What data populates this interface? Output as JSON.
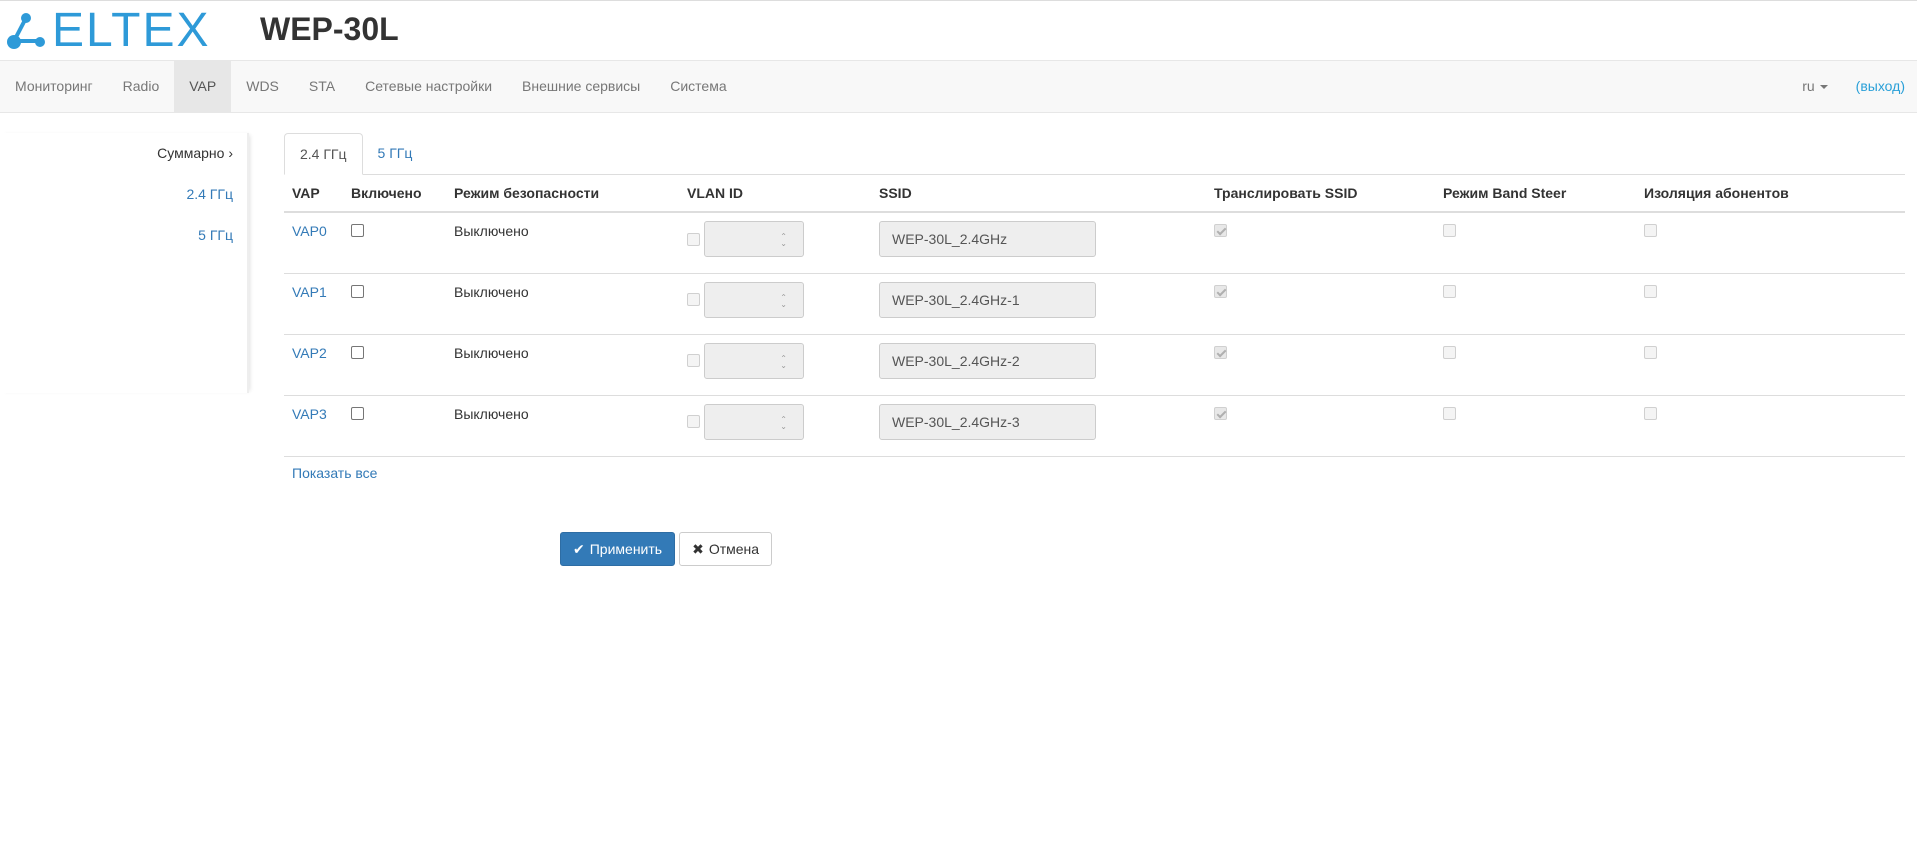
{
  "header": {
    "logo_text": "ELTEX",
    "device_title": "WEP-30L"
  },
  "nav": {
    "items": [
      {
        "label": "Мониторинг"
      },
      {
        "label": "Radio"
      },
      {
        "label": "VAP",
        "active": true
      },
      {
        "label": "WDS"
      },
      {
        "label": "STA"
      },
      {
        "label": "Сетевые настройки"
      },
      {
        "label": "Внешние сервисы"
      },
      {
        "label": "Система"
      }
    ],
    "language": "ru",
    "logout": "(выход)"
  },
  "sidebar": {
    "items": [
      {
        "label": "Суммарно ›",
        "active": true
      },
      {
        "label": "2.4 ГГц"
      },
      {
        "label": "5 ГГц"
      }
    ]
  },
  "tabs": [
    {
      "label": "2.4 ГГц",
      "active": true
    },
    {
      "label": "5 ГГц"
    }
  ],
  "table": {
    "headers": [
      "VAP",
      "Включено",
      "Режим безопасности",
      "VLAN ID",
      "SSID",
      "Транслировать SSID",
      "Режим Band Steer",
      "Изоляция абонентов"
    ],
    "rows": [
      {
        "vap": "VAP0",
        "enabled": false,
        "security": "Выключено",
        "vlan": "",
        "ssid": "WEP-30L_2.4GHz",
        "broadcast": true,
        "band_steer": false,
        "isolation": false
      },
      {
        "vap": "VAP1",
        "enabled": false,
        "security": "Выключено",
        "vlan": "",
        "ssid": "WEP-30L_2.4GHz-1",
        "broadcast": true,
        "band_steer": false,
        "isolation": false
      },
      {
        "vap": "VAP2",
        "enabled": false,
        "security": "Выключено",
        "vlan": "",
        "ssid": "WEP-30L_2.4GHz-2",
        "broadcast": true,
        "band_steer": false,
        "isolation": false
      },
      {
        "vap": "VAP3",
        "enabled": false,
        "security": "Выключено",
        "vlan": "",
        "ssid": "WEP-30L_2.4GHz-3",
        "broadcast": true,
        "band_steer": false,
        "isolation": false
      }
    ]
  },
  "show_all": "Показать все",
  "buttons": {
    "apply": "Применить",
    "cancel": "Отмена"
  },
  "colors": {
    "brand": "#2e9ad8",
    "link": "#337ab7",
    "primary": "#337ab7"
  }
}
